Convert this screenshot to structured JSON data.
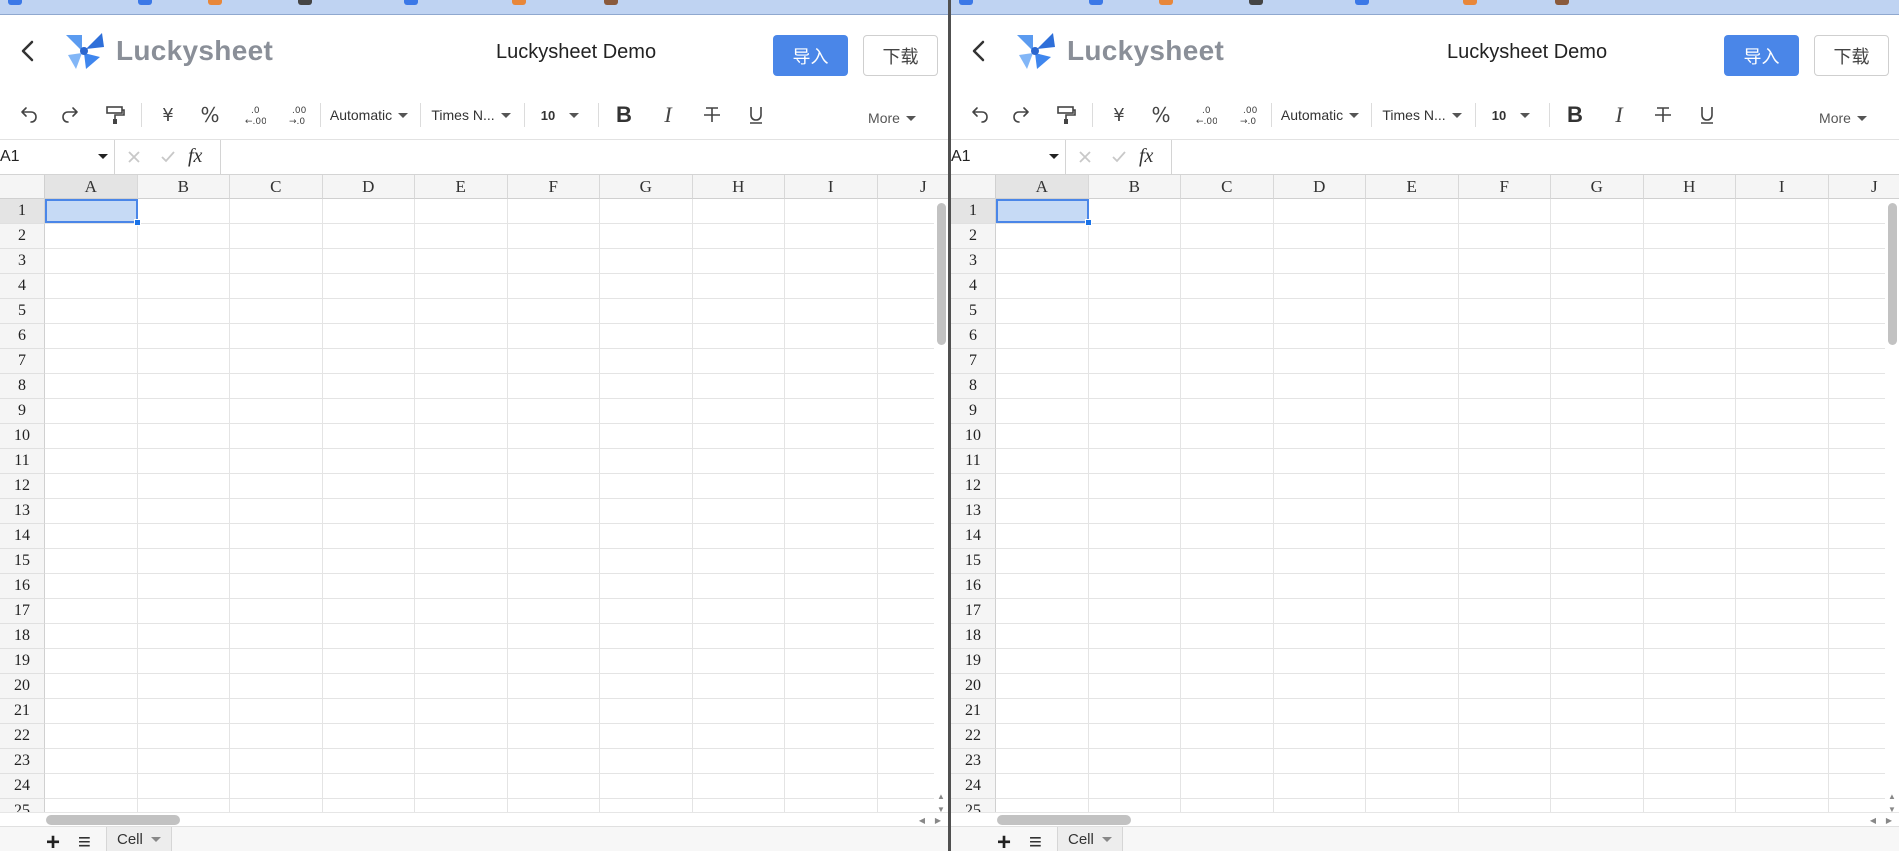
{
  "app": {
    "brand_name": "Luckysheet",
    "doc_title": "Luckysheet Demo",
    "import_label": "导入",
    "download_label": "下载",
    "accent_color": "#4a86e8"
  },
  "toolbar": {
    "undo_icon": "undo-icon",
    "redo_icon": "redo-icon",
    "format_painter_icon": "format-painter-icon",
    "currency_glyph": "¥",
    "percent_glyph": "%",
    "decimal_decrease_glyph": "←.0 .00",
    "decimal_increase_glyph": ".00 →.0",
    "number_format": "Automatic",
    "font_family": "Times N...",
    "font_size": "10",
    "bold_glyph": "B",
    "italic_glyph": "I",
    "strikethrough_glyph": "S",
    "underline_glyph": "U",
    "more_label": "More"
  },
  "formula_bar": {
    "cell_ref": "A1",
    "fx_label": "fx",
    "formula": ""
  },
  "sheet": {
    "columns": [
      "A",
      "B",
      "C",
      "D",
      "E",
      "F",
      "G",
      "H",
      "I",
      "J"
    ],
    "rows": [
      "1",
      "2",
      "3",
      "4",
      "5",
      "6",
      "7",
      "8",
      "9",
      "10",
      "11",
      "12",
      "13",
      "14",
      "15",
      "16",
      "17",
      "18",
      "19",
      "20",
      "21",
      "22",
      "23",
      "24",
      "25"
    ],
    "selected_cell": "A1",
    "tab_name": "Cell",
    "add_sheet_glyph": "+",
    "sheet_list_glyph": "≡"
  }
}
